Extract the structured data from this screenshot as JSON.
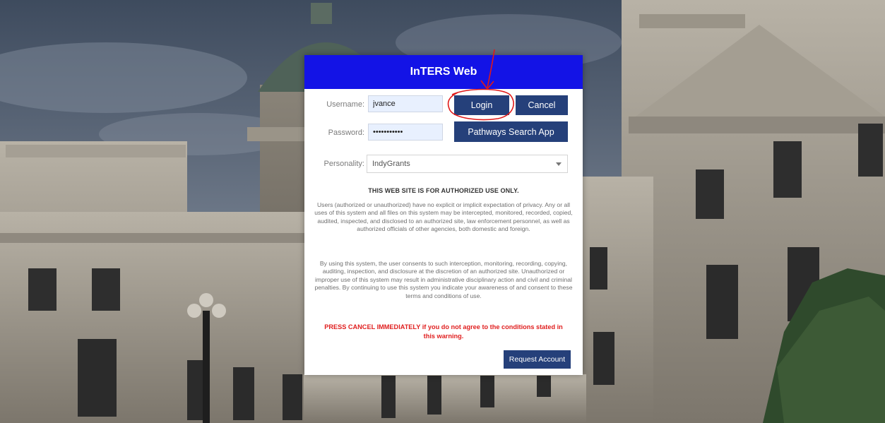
{
  "dialog": {
    "title": "InTERS Web",
    "username": {
      "label": "Username:",
      "value": "jvance"
    },
    "password": {
      "label": "Password:",
      "value": "•••••••••••"
    },
    "personality": {
      "label": "Personality:",
      "selected": "IndyGrants"
    },
    "buttons": {
      "login": "Login",
      "cancel": "Cancel",
      "pathways": "Pathways Search App",
      "request_account": "Request Account"
    },
    "warning_title": "THIS WEB SITE IS FOR AUTHORIZED USE ONLY.",
    "warning_p1": "Users (authorized or unauthorized) have no explicit or implicit expectation of privacy. Any or all uses of this system and all files on this system may be intercepted, monitored, recorded, copied, audited, inspected, and disclosed to an authorized site, law enforcement personnel, as well as authorized officials of other agencies, both domestic and foreign.",
    "warning_p2": "By using this system, the user consents to such interception, monitoring, recording, copying, auditing, inspection, and disclosure at the discretion of an authorized site. Unauthorized or improper use of this system may result in administrative disciplinary action and civil and criminal penalties. By continuing to use this system you indicate your awareness of and consent to these terms and conditions of use.",
    "warning_red": "PRESS CANCEL IMMEDIATELY if you do not agree to the conditions stated in this warning."
  },
  "colors": {
    "header": "#1313e6",
    "button": "#25407a",
    "warning_red": "#e02020",
    "annotation": "#e01818"
  },
  "icons": {
    "select_caret": "chevron-down-icon",
    "annotation": "red-circle-arrow-annotation"
  }
}
